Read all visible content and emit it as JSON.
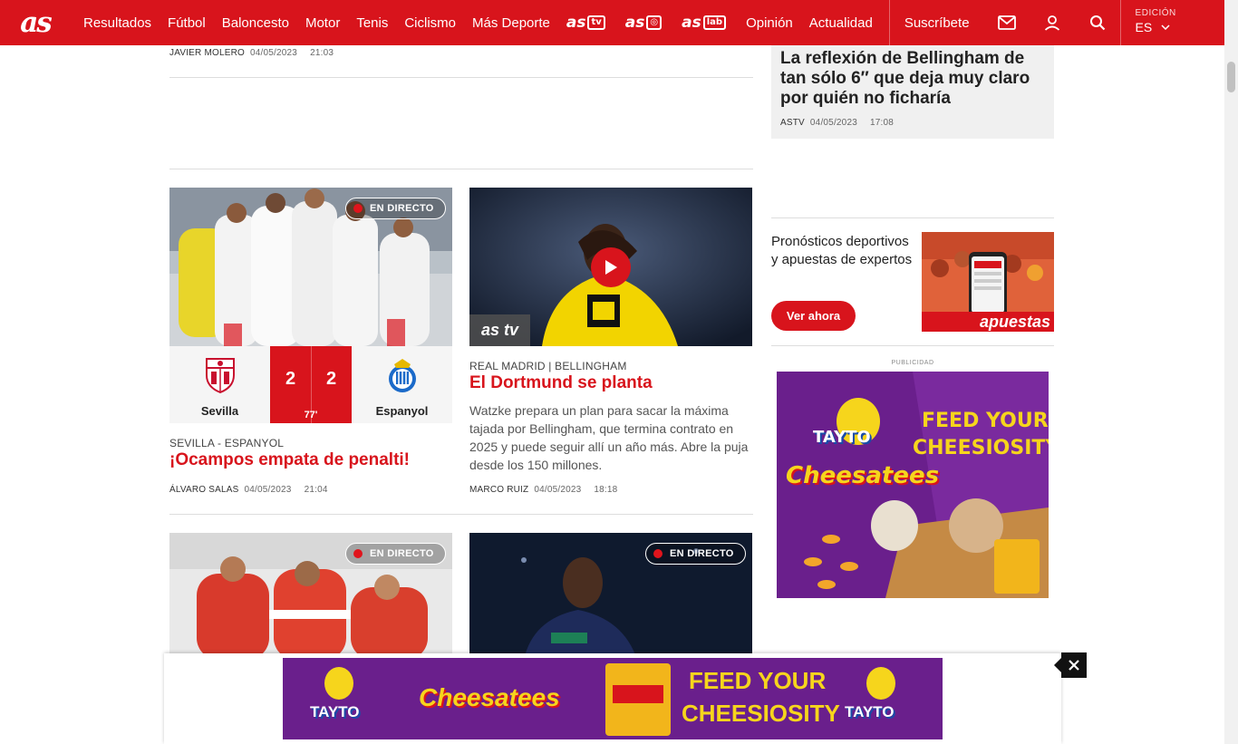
{
  "nav": {
    "logo": "as",
    "items": [
      "Resultados",
      "Fútbol",
      "Baloncesto",
      "Motor",
      "Tenis",
      "Ciclismo",
      "Más Deporte"
    ],
    "brands": [
      {
        "base": "as",
        "tag": "tv"
      },
      {
        "base": "as",
        "tag": "◎"
      },
      {
        "base": "as",
        "tag": "lab"
      }
    ],
    "items2": [
      "Opinión",
      "Actualidad"
    ],
    "subscribe": "Suscríbete",
    "edition_label": "EDICIÓN",
    "edition_value": "ES"
  },
  "prev_article": {
    "author": "JAVIER MOLERO",
    "date": "04/05/2023",
    "time": "21:03"
  },
  "cards": [
    {
      "live": "EN DIRECTO",
      "kicker": "SEVILLA - ESPANYOL",
      "title": "¡Ocampos empata de penalti!",
      "author": "ÁLVARO SALAS",
      "date": "04/05/2023",
      "time": "21:04",
      "score": {
        "home": "Sevilla",
        "home_goals": "2",
        "away": "Espanyol",
        "away_goals": "2",
        "minute": "77'"
      }
    },
    {
      "kicker": "REAL MADRID | BELLINGHAM",
      "title": "El Dortmund se planta",
      "description": "Watzke prepara un plan para sacar la máxima tajada por Bellingham, que termina contrato en 2025 y puede seguir allí un año más. Abre la puja desde los 150 millones.",
      "author": "MARCO RUIZ",
      "date": "04/05/2023",
      "time": "18:18",
      "badge": "as tv"
    },
    {
      "live": "EN DIRECTO"
    },
    {
      "live": "EN DIRECTO"
    }
  ],
  "sidebar": {
    "featured_title": "La reflexión de Bellingham de tan sólo 6″ que deja muy claro por quién no ficharía",
    "featured_author": "ASTV",
    "featured_date": "04/05/2023",
    "featured_time": "17:08",
    "promo_text": "Pronósticos deportivos y apuestas de expertos",
    "promo_button": "Ver ahora",
    "promo_brand": "apuestas",
    "ad_label": "PUBLICIDAD"
  },
  "ads": {
    "brand": "TAYTO",
    "product": "Cheesatees",
    "slogan_1": "FEED YOUR",
    "slogan_2": "CHEESIOSITY"
  },
  "colors": {
    "accent": "#d8141c",
    "ad_purple": "#6f1f8f",
    "ad_yellow": "#ffd21f"
  }
}
